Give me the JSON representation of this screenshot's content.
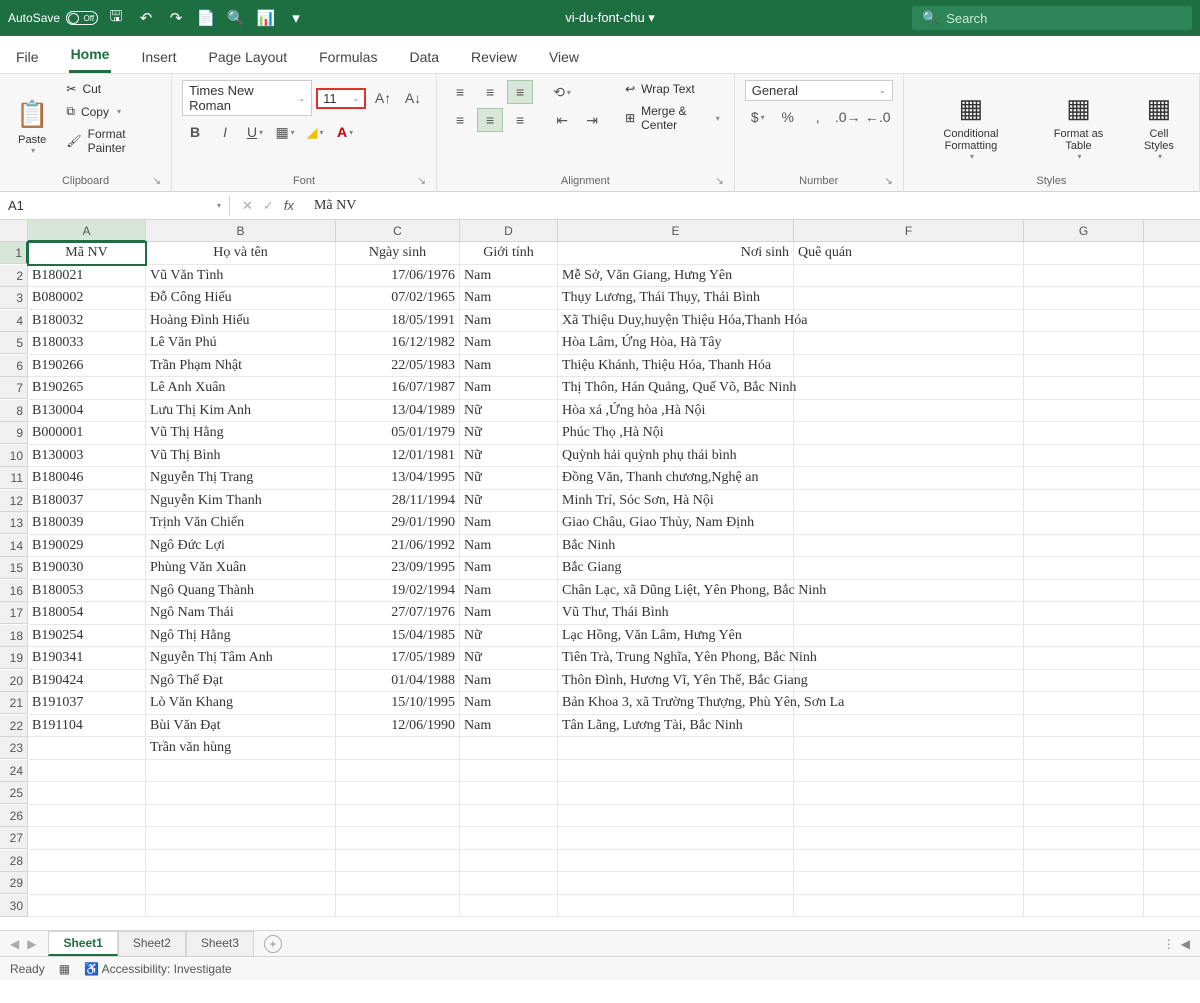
{
  "titlebar": {
    "autosave_label": "AutoSave",
    "autosave_state": "Off",
    "filename": "vi-du-font-chu ▾",
    "search_placeholder": "Search"
  },
  "tabs": [
    "File",
    "Home",
    "Insert",
    "Page Layout",
    "Formulas",
    "Data",
    "Review",
    "View"
  ],
  "active_tab": "Home",
  "ribbon": {
    "clipboard": {
      "paste": "Paste",
      "cut": "Cut",
      "copy": "Copy",
      "painter": "Format Painter",
      "label": "Clipboard"
    },
    "font": {
      "name": "Times New Roman",
      "size": "11",
      "label": "Font"
    },
    "alignment": {
      "wrap": "Wrap Text",
      "merge": "Merge & Center",
      "label": "Alignment"
    },
    "number": {
      "format": "General",
      "label": "Number"
    },
    "styles": {
      "cond": "Conditional Formatting",
      "table": "Format as Table",
      "cell": "Cell Styles",
      "label": "Styles"
    }
  },
  "formulabar": {
    "name_box": "A1",
    "formula": "Mã NV"
  },
  "columns": [
    "A",
    "B",
    "C",
    "D",
    "E",
    "F",
    "G"
  ],
  "headers": {
    "A": "Mã NV",
    "B": "Họ và tên",
    "C": "Ngày sinh",
    "D": "Giới tính",
    "E": "Nơi sinh",
    "F": "Quê quán"
  },
  "rows": [
    {
      "n": 1
    },
    {
      "n": 2,
      "A": "B180021",
      "B": "Vũ Văn Tình",
      "C": "17/06/1976",
      "D": "Nam",
      "E": "Mễ Sở, Văn Giang, Hưng Yên"
    },
    {
      "n": 3,
      "A": "B080002",
      "B": "Đỗ Công Hiếu",
      "C": "07/02/1965",
      "D": "Nam",
      "E": "Thụy Lương, Thái Thụy, Thái Bình"
    },
    {
      "n": 4,
      "A": "B180032",
      "B": "Hoàng Đình Hiếu",
      "C": "18/05/1991",
      "D": "Nam",
      "E": "Xã Thiệu Duy,huyện Thiệu Hóa,Thanh Hóa"
    },
    {
      "n": 5,
      "A": "B180033",
      "B": "Lê Văn Phú",
      "C": "16/12/1982",
      "D": "Nam",
      "E": "Hòa Lâm, Ứng Hòa, Hà Tây"
    },
    {
      "n": 6,
      "A": "B190266",
      "B": "Trần Phạm Nhật",
      "C": "22/05/1983",
      "D": "Nam",
      "E": "Thiệu Khánh, Thiệu Hóa, Thanh Hóa"
    },
    {
      "n": 7,
      "A": "B190265",
      "B": "Lê Anh Xuân",
      "C": "16/07/1987",
      "D": "Nam",
      "E": "Thị Thôn, Hán Quảng, Quế Võ, Bắc Ninh"
    },
    {
      "n": 8,
      "A": "B130004",
      "B": "Lưu Thị Kim Anh",
      "C": "13/04/1989",
      "D": "Nữ",
      "E": "Hòa xá ,Ứng hòa ,Hà Nội"
    },
    {
      "n": 9,
      "A": "B000001",
      "B": "Vũ Thị Hằng",
      "C": "05/01/1979",
      "D": "Nữ",
      "E": "Phúc Thọ ,Hà Nội"
    },
    {
      "n": 10,
      "A": "B130003",
      "B": "Vũ Thị Bình",
      "C": "12/01/1981",
      "D": "Nữ",
      "E": "Quỳnh hải quỳnh phụ thái bình"
    },
    {
      "n": 11,
      "A": "B180046",
      "B": "Nguyễn Thị Trang",
      "C": "13/04/1995",
      "D": "Nữ",
      "E": "Đồng Văn, Thanh chương,Nghệ an"
    },
    {
      "n": 12,
      "A": "B180037",
      "B": "Nguyễn Kim Thanh",
      "C": "28/11/1994",
      "D": "Nữ",
      "E": "Minh Trí, Sóc Sơn, Hà Nội"
    },
    {
      "n": 13,
      "A": "B180039",
      "B": "Trịnh Văn Chiến",
      "C": "29/01/1990",
      "D": "Nam",
      "E": "Giao Châu, Giao Thủy, Nam Định"
    },
    {
      "n": 14,
      "A": "B190029",
      "B": "Ngô Đức Lợi",
      "C": "21/06/1992",
      "D": "Nam",
      "E": "Bắc Ninh"
    },
    {
      "n": 15,
      "A": "B190030",
      "B": "Phùng Văn Xuân",
      "C": "23/09/1995",
      "D": "Nam",
      "E": "Bắc Giang"
    },
    {
      "n": 16,
      "A": "B180053",
      "B": "Ngô Quang Thành",
      "C": "19/02/1994",
      "D": "Nam",
      "E": "Chân Lạc, xã Dũng Liệt, Yên Phong, Bắc Ninh"
    },
    {
      "n": 17,
      "A": "B180054",
      "B": "Ngô Nam Thái",
      "C": "27/07/1976",
      "D": "Nam",
      "E": "Vũ Thư, Thái Bình"
    },
    {
      "n": 18,
      "A": "B190254",
      "B": "Ngô Thị Hằng",
      "C": "15/04/1985",
      "D": "Nữ",
      "E": "Lạc Hồng, Văn Lâm, Hưng Yên"
    },
    {
      "n": 19,
      "A": "B190341",
      "B": "Nguyễn Thị Tâm Anh",
      "C": "17/05/1989",
      "D": "Nữ",
      "E": "Tiên Trà, Trung Nghĩa, Yên Phong, Bắc Ninh"
    },
    {
      "n": 20,
      "A": "B190424",
      "B": "Ngô Thế Đạt",
      "C": "01/04/1988",
      "D": "Nam",
      "E": "Thôn Đình, Hương Vĩ, Yên Thế, Bắc Giang"
    },
    {
      "n": 21,
      "A": "B191037",
      "B": "Lò Văn Khang",
      "C": "15/10/1995",
      "D": "Nam",
      "E": "Bản Khoa 3, xã Trường Thượng, Phù Yên, Sơn La"
    },
    {
      "n": 22,
      "A": "B191104",
      "B": "Bùi Văn Đạt",
      "C": "12/06/1990",
      "D": "Nam",
      "E": "Tân Lãng, Lương Tài, Bắc Ninh"
    },
    {
      "n": 23,
      "B": "Trần văn hùng"
    },
    {
      "n": 24
    },
    {
      "n": 25
    },
    {
      "n": 26
    },
    {
      "n": 27
    },
    {
      "n": 28
    },
    {
      "n": 29
    },
    {
      "n": 30
    }
  ],
  "sheets": [
    "Sheet1",
    "Sheet2",
    "Sheet3"
  ],
  "active_sheet": "Sheet1",
  "statusbar": {
    "ready": "Ready",
    "accessibility": "Accessibility: Investigate"
  }
}
